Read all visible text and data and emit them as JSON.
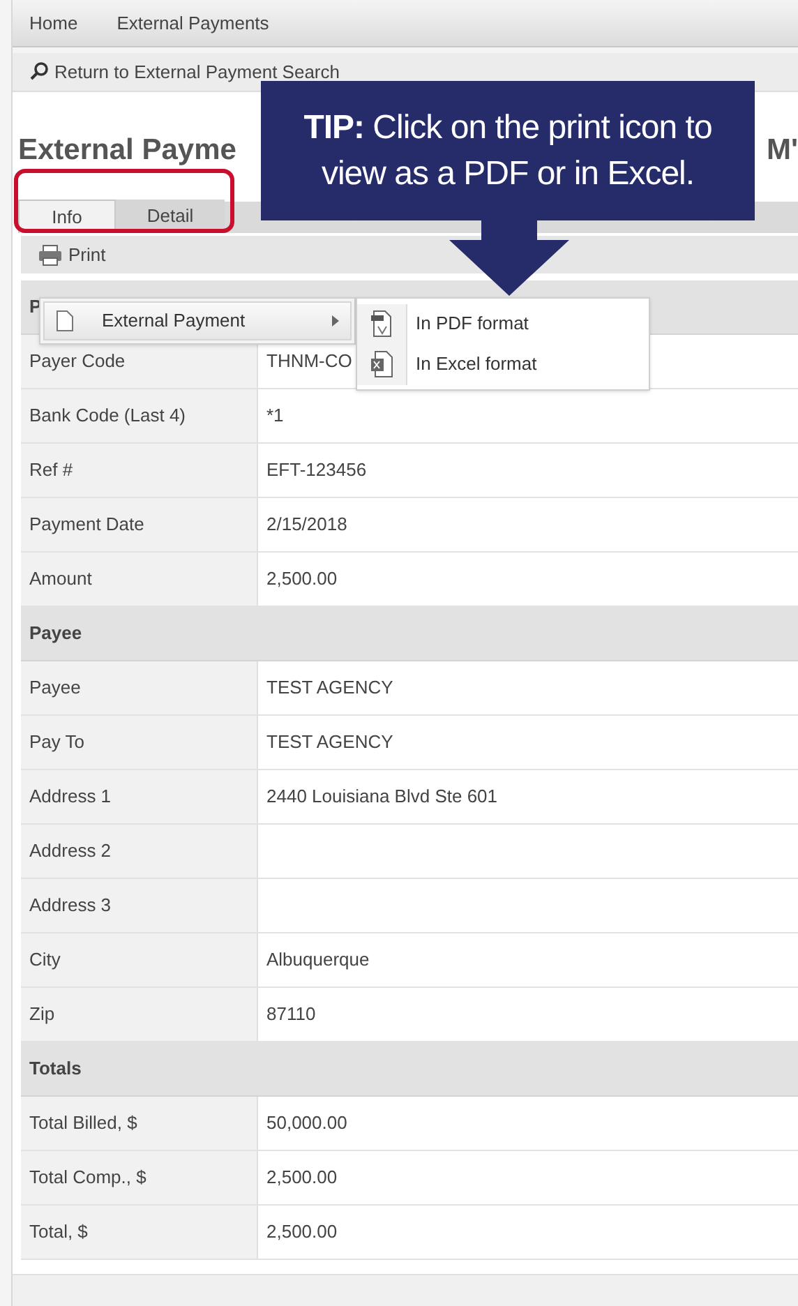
{
  "nav": [
    {
      "label": "Home"
    },
    {
      "label": "External Payments"
    }
  ],
  "toolbar": {
    "link": "Return to External Payment Search"
  },
  "title": {
    "start": "External Payme",
    "end": "M'"
  },
  "tabs": [
    {
      "label": "Info",
      "selected": true
    },
    {
      "label": "Detail",
      "selected": false
    }
  ],
  "print": {
    "label": "Print"
  },
  "sections": [
    {
      "heading": "P",
      "rows": [
        {
          "label": "Payer Code",
          "value": "THNM-CO"
        },
        {
          "label": "Bank Code (Last 4)",
          "value": "*1"
        },
        {
          "label": "Ref #",
          "value": "EFT-123456"
        },
        {
          "label": "Payment Date",
          "value": "2/15/2018"
        },
        {
          "label": "Amount",
          "value": "2,500.00"
        }
      ]
    },
    {
      "heading": "Payee",
      "rows": [
        {
          "label": "Payee",
          "value": "TEST AGENCY"
        },
        {
          "label": "Pay To",
          "value": "TEST AGENCY"
        },
        {
          "label": "Address 1",
          "value": "2440 Louisiana Blvd Ste 601"
        },
        {
          "label": "Address 2"
        },
        {
          "label": "Address 3"
        },
        {
          "label": "City",
          "value": "Albuquerque"
        },
        {
          "label": "Zip",
          "value": "87110"
        }
      ]
    },
    {
      "heading": "Totals",
      "rows": [
        {
          "label": "Total Billed, $",
          "value": "50,000.00"
        },
        {
          "label": "Total Comp., $",
          "value": "2,500.00"
        },
        {
          "label": "Total, $",
          "value": "2,500.00"
        }
      ]
    }
  ],
  "menu": {
    "item": "External Payment",
    "submenu": [
      {
        "kind": "pdf",
        "label": "In PDF format"
      },
      {
        "kind": "excel",
        "label": "In Excel format"
      }
    ]
  },
  "tip": {
    "text": "**TIP:** Click on the print icon to view as a PDF or in Excel."
  }
}
